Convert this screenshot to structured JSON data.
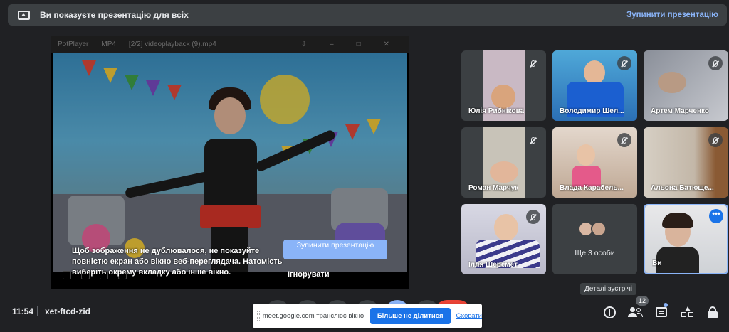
{
  "banner": {
    "icon": "present-to-all-icon",
    "title": "Ви показуєте презентацію для всіх",
    "stop_label": "Зупинити презентацію"
  },
  "presentation": {
    "player_app": "PotPlayer",
    "player_format": "MP4",
    "player_file": "[2/2] videoplayback (9).mp4",
    "warning_text": "Щоб зображення не дублювалося, не показуйте повністю екран або вікно веб-переглядача. Натомість виберіть окрему вкладку або інше вікно.",
    "stop_button_label": "Зупинити презентацію",
    "ignore_button_label": "Ігнорувати"
  },
  "participants": [
    {
      "name": "Юлія Рибнікова",
      "muted": true
    },
    {
      "name": "Володимир Шел...",
      "muted": true
    },
    {
      "name": "Артем Марченко",
      "muted": true
    },
    {
      "name": "Роман Марчук",
      "muted": true
    },
    {
      "name": "Влада Карабель...",
      "muted": true
    },
    {
      "name": "Альона Батюще...",
      "muted": true
    },
    {
      "name": "Ілля Шеремет",
      "muted": true
    }
  ],
  "others": {
    "label": "Ще 3 особи"
  },
  "self_tile": {
    "name": "Ви",
    "menu_icon": "more-dots-icon"
  },
  "bottom_bar": {
    "time": "11:54",
    "meeting_code": "xet-ftcd-zid",
    "tooltip": "Деталі зустрічі",
    "participants_count": "12",
    "colors": {
      "end_call": "#ea4335",
      "present": "#8ab4f8"
    }
  },
  "share_notice": {
    "message": "meet.google.com транслює вікно.",
    "stop_label": "Більше не ділитися",
    "hide_label": "Сховати"
  }
}
